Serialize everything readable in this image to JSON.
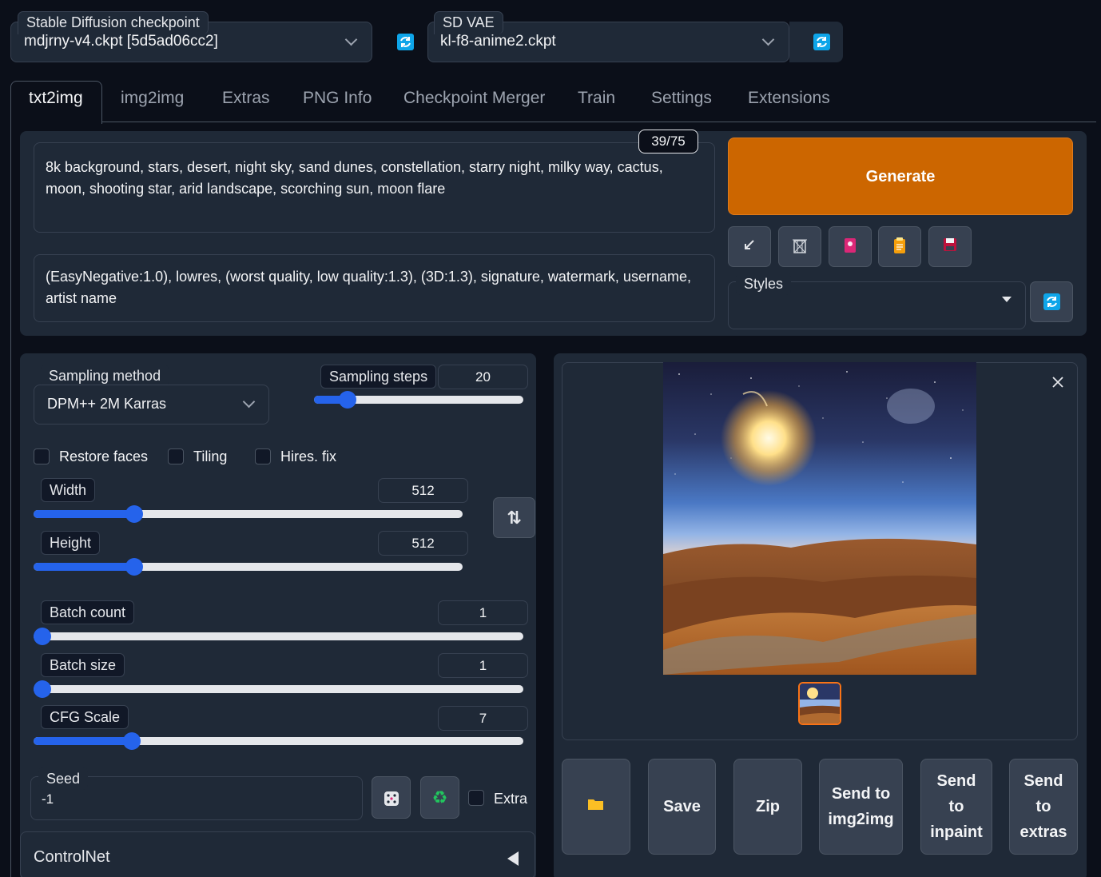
{
  "top": {
    "checkpoint_label": "Stable Diffusion checkpoint",
    "checkpoint_value": "mdjrny-v4.ckpt [5d5ad06cc2]",
    "vae_label": "SD VAE",
    "vae_value": "kl-f8-anime2.ckpt"
  },
  "tabs": [
    {
      "label": "txt2img",
      "active": true
    },
    {
      "label": "img2img"
    },
    {
      "label": "Extras"
    },
    {
      "label": "PNG Info"
    },
    {
      "label": "Checkpoint Merger"
    },
    {
      "label": "Train"
    },
    {
      "label": "Settings"
    },
    {
      "label": "Extensions"
    }
  ],
  "prompt": {
    "positive": "8k background, stars, desert, night sky, sand dunes, constellation, starry night, milky way, cactus, moon, shooting star, arid landscape, scorching sun, moon flare",
    "negative": "(EasyNegative:1.0), lowres, (worst quality, low quality:1.3), (3D:1.3), signature, watermark, username, artist name",
    "token_counter": "39/75"
  },
  "generate_label": "Generate",
  "tool_icons": [
    "arrow-icon",
    "trash-icon",
    "art-icon",
    "clipboard-icon",
    "save-disk-icon"
  ],
  "styles_label": "Styles",
  "sampling": {
    "method_label": "Sampling method",
    "method_value": "DPM++ 2M Karras",
    "steps_label": "Sampling steps",
    "steps_value": "20",
    "steps_fraction": 0.16
  },
  "options": {
    "restore_faces": "Restore faces",
    "tiling": "Tiling",
    "hires_fix": "Hires. fix"
  },
  "width": {
    "label": "Width",
    "value": "512",
    "fraction": 0.235
  },
  "height": {
    "label": "Height",
    "value": "512",
    "fraction": 0.235
  },
  "batch_count": {
    "label": "Batch count",
    "value": "1",
    "fraction": 0.0
  },
  "batch_size": {
    "label": "Batch size",
    "value": "1",
    "fraction": 0.0
  },
  "cfg_scale": {
    "label": "CFG Scale",
    "value": "7",
    "fraction": 0.2
  },
  "seed": {
    "label": "Seed",
    "value": "-1",
    "extra_label": "Extra"
  },
  "controlnet_label": "ControlNet",
  "actions": {
    "folder_icon": "folder-icon",
    "save": "Save",
    "zip": "Zip",
    "send_img2img": "Send to img2img",
    "send_inpaint": "Send to inpaint",
    "send_extras": "Send to extras"
  },
  "colors": {
    "generate": "#cc6600",
    "accent": "#2563eb",
    "refresh": "#0ea5e9"
  }
}
